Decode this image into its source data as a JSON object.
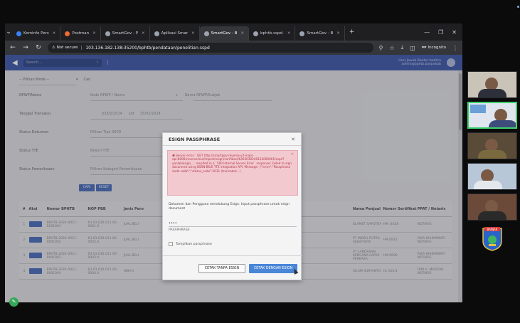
{
  "browser": {
    "tabs": [
      {
        "label": "Kominfo Pers",
        "color": "#3b82f6"
      },
      {
        "label": "Postman",
        "color": "#ef6a32"
      },
      {
        "label": "SmartGov - P",
        "color": "#9ca3af"
      },
      {
        "label": "Aplikasi Smar",
        "color": "#9ca3af"
      },
      {
        "label": "SmartGov - B",
        "color": "#9ca3af",
        "active": true
      },
      {
        "label": "bphtb-sspd-",
        "color": "#9ca3af"
      },
      {
        "label": "SmartGov - B",
        "color": "#9ca3af"
      }
    ],
    "not_secure": "Not secure",
    "url": "103.136.182.138:35200/bphtb/pendataan/penelitian-sspd",
    "incognito": "Incognito"
  },
  "app": {
    "search_placeholder": "Search...",
    "user_line1": "User Jawab Bantar Isadhra",
    "user_line2": "admin@bphtb.banjarkab"
  },
  "form": {
    "pilih_label": "-- Pilihan Mode --",
    "cari_value": "Cari",
    "rows": [
      {
        "label": "NPWP/Nama",
        "value": "Kode NPWP / Nama",
        "value2": "Nama NPWP/Subjek"
      },
      {
        "label": "Tanggal Transaksi",
        "value": "03/02/2024",
        "sep": "s/d",
        "value2": "15/02/2024"
      },
      {
        "label": "Status Dokumen",
        "value": "Pilihan Tipe SSPD"
      },
      {
        "label": "Status TTE",
        "value": "Belum TTE"
      },
      {
        "label": "Status Pemeriksaan",
        "value": "Pilihan Kategori Pemeriksaan"
      }
    ],
    "btn_cari": "CARI",
    "btn_reset": "RESET"
  },
  "table": {
    "headers": [
      "#",
      "Aksi",
      "Nomor BPHTB",
      "NOP PBB",
      "Jenis Pero",
      "",
      "Nama Penjual",
      "Nomor Sertifikat",
      "PPAT / Notaris"
    ],
    "rows": [
      {
        "no": "1",
        "nomor": "BPHTB-2024-0021-0001001",
        "nop": "63.03.030.011.00-0001.0",
        "jenis": "JUAL BELI",
        "nama": "SLAMET SAPUTRA",
        "sert": "HM. 4458",
        "ppat": "NOTARIS"
      },
      {
        "no": "2",
        "nomor": "BPHTB-2024-0021-0001002",
        "nop": "63.03.030.011.00-0002.0",
        "jenis": "JUAL BELI",
        "nama": "PT INDAH PUTRA SEJAHTERA",
        "sert": "HM.0812",
        "ppat": "RIKA RAHMAWATI NOTARIS"
      },
      {
        "no": "3",
        "nomor": "BPHTB-2024-0021-0001003",
        "nop": "63.03.030.011.00-0003.0",
        "jenis": "JUAL BELI",
        "nama": "PT LANDASAN KENCANA LAPAK PERKASA",
        "sert": "HM.0000",
        "ppat": "RIKA RAHMAWATI NOTARIS"
      },
      {
        "no": "4",
        "nomor": "BPHTB-2024-0021-0001004",
        "nop": "63.03.030.011.00-0004.0",
        "jenis": "HIBAH",
        "nama": "ISLAM SURYANTO",
        "sert": "HL 001/1",
        "ppat": "DINI A. MASITAH NOTARIS"
      }
    ]
  },
  "modal": {
    "title": "ESIGN PASSPHRASE",
    "error": "Server error: `GET http://smartgov-reverse-v2-main-api:8000/reverse/sso/import/esign/verifikasi/6303030240132000001/sspd?yonlah&sign...` resulted in a `500 Internal Server Error` response: Failed to sign document using BSSN-BSrE TTE integration API. Message: {\"error\":\"Passphrase anda salah\",\"status_code\":2031 (truncated...)",
    "desc": "Dokumen dan Pengguna mendukung Esign. Input passphrase untuk esign document",
    "passphrase_value": "••••",
    "passphrase_label": "PASSPHRASE",
    "show_label": "Tampilkan passphrase",
    "btn_without": "CETAK TANPA ESIGN",
    "btn_with": "CETAK DENGAN ESIGN"
  },
  "colors": {
    "header": "#3e58a8",
    "primary_btn": "#4a86d8",
    "alert_bg": "#f2c9cf",
    "alert_text": "#b3364a",
    "video_border_active": "#3fd16e"
  },
  "video": {
    "logo_text": "BANJAR"
  }
}
